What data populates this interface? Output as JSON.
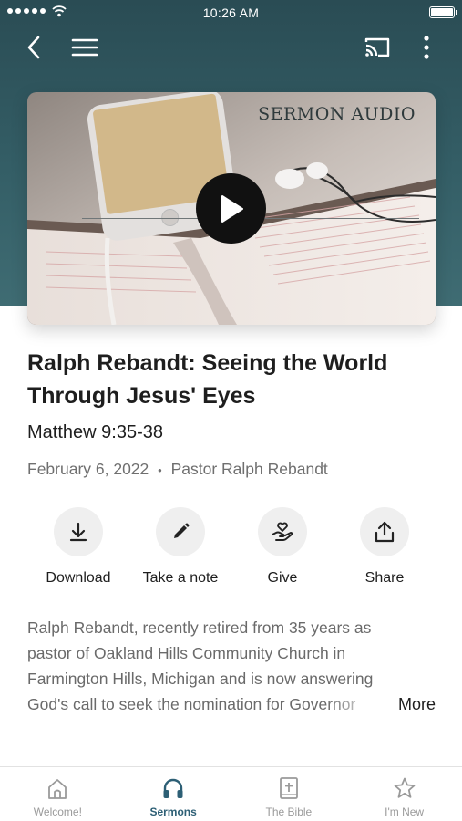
{
  "status_bar": {
    "time": "10:26 AM"
  },
  "nav": {
    "back_icon": "chevron-left-icon",
    "menu_icon": "hamburger-menu-icon",
    "cast_icon": "cast-icon",
    "more_icon": "more-vertical-icon"
  },
  "hero": {
    "label": "SERMON AUDIO",
    "play_icon": "play-icon"
  },
  "sermon": {
    "title": "Ralph Rebandt: Seeing the World Through Jesus' Eyes",
    "scripture": "Matthew 9:35-38",
    "date": "February 6, 2022",
    "separator": "•",
    "speaker": "Pastor Ralph Rebandt"
  },
  "actions": [
    {
      "label": "Download",
      "icon": "download-icon"
    },
    {
      "label": "Take a note",
      "icon": "pencil-icon"
    },
    {
      "label": "Give",
      "icon": "give-hand-heart-icon"
    },
    {
      "label": "Share",
      "icon": "share-icon"
    }
  ],
  "description": {
    "lines": [
      "Ralph Rebandt, recently retired from 35 years as",
      "pastor of Oakland Hills Community Church in",
      "Farmington Hills, Michigan and is now answering",
      "God's call to seek the nomination for Governor"
    ],
    "more_label": "More"
  },
  "tabs": [
    {
      "label": "Welcome!",
      "icon": "church-icon",
      "active": false
    },
    {
      "label": "Sermons",
      "icon": "headphones-icon",
      "active": true
    },
    {
      "label": "The Bible",
      "icon": "bible-icon",
      "active": false
    },
    {
      "label": "I'm New",
      "icon": "star-icon",
      "active": false
    }
  ],
  "colors": {
    "header_bg": "#2f555d",
    "active_tab": "#2d5f75",
    "inactive_tab": "#9a9a9a",
    "muted_text": "#6f6f6f"
  }
}
